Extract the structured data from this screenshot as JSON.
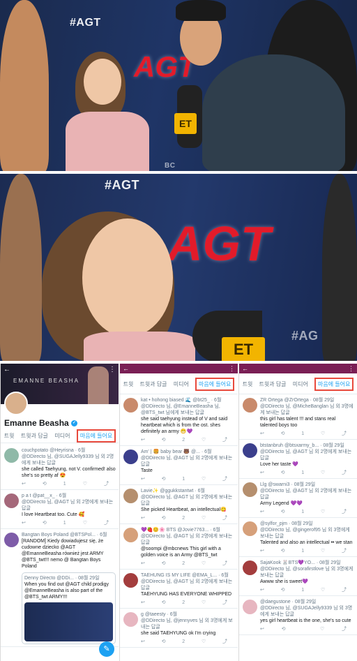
{
  "photo1": {
    "hashtag": "#AGT",
    "logo": "AGT",
    "mic_label": "ET",
    "corner_text": "BC"
  },
  "photo2": {
    "hashtag": "#AGT",
    "logo": "AGT",
    "hashtag2": "#AG",
    "mic_label": "ET"
  },
  "panelA": {
    "banner_text": "EMANNE   BEASHA",
    "name": "Emanne Beasha",
    "tabs": [
      "트윗",
      "트윗과 답글",
      "미디어",
      "마음에 들어요"
    ],
    "tweets": [
      {
        "head": "couchpotato @Heyrisna · 6월",
        "reply": "@DDirecto 님, @SUGAJelly9339 님 외 2명에게 보내는 답글",
        "text": "she called Taehyung, not V. confirmed! also she's so pretty af 😍",
        "counts": [
          "",
          "1",
          "1"
        ]
      },
      {
        "head": "p a t @pat__x_ · 6월",
        "reply": "@DDirecto 님, @AGT 님 외 2명에게 보내는 답글",
        "text": "I love Heartbeat too. Cute 🥰",
        "counts": [
          "",
          "",
          "1"
        ]
      },
      {
        "head": "Bangtan Boys Poland @BTSPol... · 6월",
        "reply": "",
        "text": "[RANDOM] Kiedy dowiadujesz się, że cudowne dziecko @AGT @EmanneBeasha również jest ARMY @BTS_twt!!!  nemo @ Bangtan Boys Poland",
        "counts": [
          "",
          "",
          ""
        ]
      },
      {
        "head": "Denny Directo @DDi... · 08월 29일",
        "reply": "",
        "text": "When you find out @AGT child prodigy @EmanneBeasha is also part of the @BTS_twt ARMY!!!",
        "counts": [
          "",
          "",
          ""
        ]
      }
    ]
  },
  "panelB": {
    "tabs": [
      "트윗",
      "트윗과 답글",
      "미디어",
      "마음에 들어요"
    ],
    "tweets": [
      {
        "head": "kat • hohong biased 🌊 @bt25_ · 6월",
        "reply": "@DDirecto 님, @EmanneBeasha 님, @BTS_twt 님에게 보내는 답글",
        "text": "she said taehyung instead of V and said heartbeat which is from the ost. shes definitely an army 😁💜",
        "counts": [
          "",
          "",
          "2"
        ]
      },
      {
        "head": "Am' | 🍔 baby bear 🐻 @... · 6월",
        "reply": "@DDirecto 님, @AGT 님 외 2명에게 보내는 답글",
        "text": "Taste",
        "counts": [
          "",
          "",
          "1"
        ]
      },
      {
        "head": "Lavie✨ @ggukkstantwt · 6월",
        "reply": "@DDirecto 님, @AGT 님 외 2명에게 보내는 답글",
        "text": "She picked Heartbeat, an intellectual😋",
        "counts": [
          "",
          "",
          "2"
        ]
      },
      {
        "head": "💜🍓😊🌸 BTS @Jovie7763... · 6월",
        "reply": "@DDirecto 님, @AGT 님 외 2명에게 보내는 답글",
        "text": "@soompi @mbcnews This girl with a golden voice is an Army @BTS_twt",
        "counts": [
          "",
          "",
          "2"
        ]
      },
      {
        "head": "TAEHUNG IS MY LIFE @EMA_L... · 6월",
        "reply": "@DDirecto 님, @AGT 님 외 2명에게 보내는 답글",
        "text": "TAEHYUNG HAS EVERYONE WHIPPED",
        "counts": [
          "",
          "",
          "2"
        ]
      },
      {
        "head": "g @taeesty · 6월",
        "reply": "@DDirecto 님, @jennyves 님 외 3명에게 보내는 답글",
        "text": "she said TAEHYUNG ok I'm crying",
        "counts": [
          "",
          "",
          "2"
        ]
      }
    ]
  },
  "panelC": {
    "tabs": [
      "트윗",
      "트윗과 답글",
      "미디어",
      "마음에 들어요"
    ],
    "tweets": [
      {
        "head": "ZR Ortega @ZrOrtega · 08월 29일",
        "reply": "@DDirecto 님, @MicheBanglan 님 외 3명에게 보내는 답글",
        "text": "this girl has talent !!! and stans real talented boys too",
        "counts": [
          "",
          "",
          "1"
        ]
      },
      {
        "head": "btstanbruh @btsxarmy_b... · 08월 29일",
        "reply": "@DDirecto 님, @AGT 님 외 2명에게 보내는 답글",
        "text": "Love her taste 💜",
        "counts": [
          "",
          "",
          "1"
        ]
      },
      {
        "head": "Llg @swarni3 · 08월 29일",
        "reply": "@DDirecto 님, @AGT 님 외 2명에게 보내는 답글",
        "text": "Army Legend 💜💜",
        "counts": [
          "",
          "",
          "1"
        ]
      },
      {
        "head": "@sylfor_pjm · 08월 29일",
        "reply": "@DDirecto 님, @gingerof95 님 외 3명에게 보내는 답글",
        "text": "Talented and also an intellectual •• we stan",
        "counts": [
          "",
          "",
          "1"
        ]
      },
      {
        "head": "SajaKook 🐰BTS💜YO... · 08월 29일",
        "reply": "@DDirecto 님, @sorafirstlove 님 외 3명에게 보내는 답글",
        "text": "Awww she is sweet💜",
        "counts": [
          "",
          "",
          "1"
        ]
      },
      {
        "head": "@daegustone · 08월 29일",
        "reply": "@DDirecto 님, @SUGAJelly9339 님 외 3명에게 보내는 답글",
        "text": "yes girl heartbeat is the one, she's so cute",
        "counts": [
          "",
          "",
          ""
        ]
      }
    ]
  },
  "icons": {
    "reply": "↩",
    "retweet": "⟲",
    "like": "♡",
    "share": "⤴",
    "compose": "✎",
    "back": "←",
    "more": "⋮"
  },
  "colors": {
    "highlight": "#e8493c",
    "twitter_blue": "#1da1f2",
    "topbar": "#7a1f55"
  }
}
